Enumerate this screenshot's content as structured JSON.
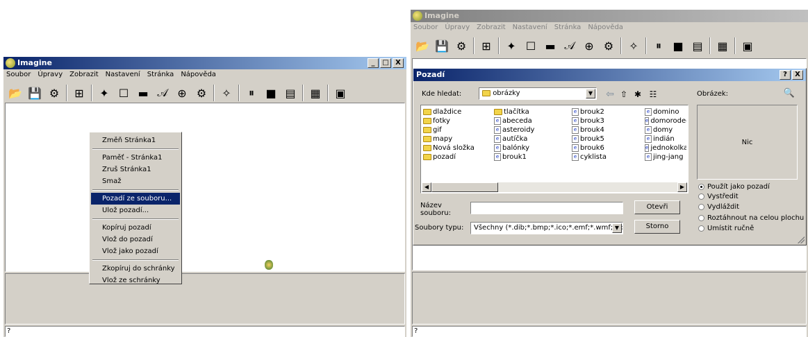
{
  "left_window": {
    "title": "Imagine",
    "menu": [
      "Soubor",
      "Úpravy",
      "Zobrazit",
      "Nastavení",
      "Stránka",
      "Nápověda"
    ],
    "title_buttons": [
      "_",
      "□",
      "X"
    ],
    "status_text": "?"
  },
  "context_menu": {
    "items": [
      "Změň Stránka1",
      "Paměť - Stránka1",
      "Zruš Stránka1",
      "Smaž",
      "Pozadí ze souboru...",
      "Ulož pozadí...",
      "Kopíruj pozadí",
      "Vlož do pozadí",
      "Vlož jako pozadí",
      "Zkopíruj do schránky",
      "Vlož ze schránky"
    ],
    "selected_index": 4
  },
  "right_window": {
    "title": "Imagine",
    "menu": [
      "Soubor",
      "Úpravy",
      "Zobrazit",
      "Nastavení",
      "Stránka",
      "Nápověda"
    ],
    "status_text": "?"
  },
  "dialog": {
    "title": "Pozadí",
    "title_buttons": [
      "?",
      "X"
    ],
    "look_in_label": "Kde hledat:",
    "look_in_value": "obrázky",
    "image_label": "Obrázek:",
    "preview_text": "Nic",
    "folders": [
      "dlaždice",
      "fotky",
      "gif",
      "mapy",
      "Nová složka",
      "pozadí",
      "tlačítka"
    ],
    "files": [
      "abeceda",
      "asteroidy",
      "autíčka",
      "balónky",
      "brouk1",
      "brouk2",
      "brouk3",
      "brouk4",
      "brouk5",
      "brouk6",
      "cyklista",
      "domino",
      "domorodec",
      "domy",
      "indián",
      "jednokolka",
      "jing-jang"
    ],
    "filename_label": "Název souboru:",
    "filename_value": "",
    "filetype_label": "Soubory typu:",
    "filetype_value": "Všechny (*.dib;*.bmp;*.ico;*.emf;*.wmf;*.jpg;*",
    "open_button": "Otevři",
    "cancel_button": "Storno",
    "options": [
      "Použít jako pozadí",
      "Vystředit",
      "Vydláždit",
      "Roztáhnout na celou plochu",
      "Umístit ručně"
    ],
    "selected_option": 0
  }
}
